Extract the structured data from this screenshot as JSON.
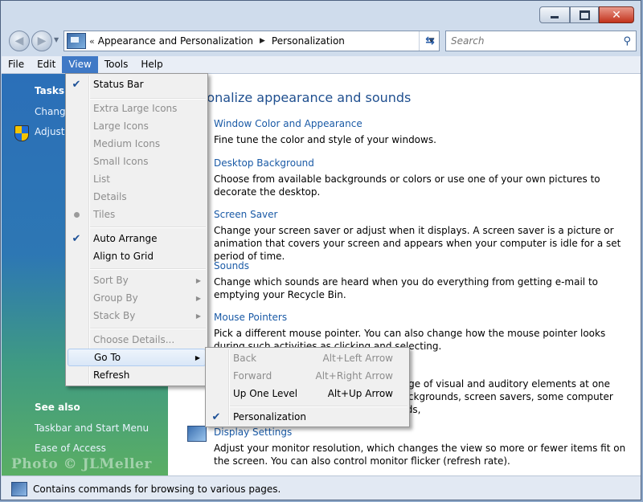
{
  "window": {
    "address": {
      "crumbs": [
        "Appearance and Personalization",
        "Personalization"
      ],
      "overflow_glyph": "«",
      "separator_glyph": "▶"
    },
    "search": {
      "placeholder": "Search"
    }
  },
  "menubar": {
    "items": [
      "File",
      "Edit",
      "View",
      "Tools",
      "Help"
    ],
    "active": "View"
  },
  "left_pane": {
    "tasks_heading": "Tasks",
    "tasks": [
      "Change",
      "Adjust"
    ],
    "see_also_heading": "See also",
    "see_also": [
      "Taskbar and Start Menu",
      "Ease of Access"
    ],
    "watermark": "Photo © JLMeller"
  },
  "main": {
    "title": "sonalize appearance and sounds",
    "items": [
      {
        "link": "Window Color and Appearance",
        "desc": "Fine tune the color and style of your windows."
      },
      {
        "link": "Desktop Background",
        "desc": "Choose from available backgrounds or colors or use one of your own pictures to decorate the desktop."
      },
      {
        "link": "Screen Saver",
        "desc": "Change your screen saver or adjust when it displays. A screen saver is a picture or animation that covers your screen and appears when your computer is idle for a set period of time."
      },
      {
        "link": "Sounds",
        "desc": "Change which sounds are heard when you do everything from getting e-mail to emptying your Recycle Bin."
      },
      {
        "link": "Mouse Pointers",
        "desc": "Pick a different mouse pointer. You can also change how the mouse pointer looks during such activities as clicking and selecting."
      },
      {
        "link": "",
        "desc": "e range of visual and auditory elements at one time ckgrounds, screen savers, some computer sounds,"
      },
      {
        "link": "Display Settings",
        "desc": "Adjust your monitor resolution, which changes the view so more or fewer items fit on the screen. You can also control monitor flicker (refresh rate)."
      }
    ]
  },
  "view_menu": {
    "items": [
      {
        "label": "Status Bar",
        "checked": true,
        "disabled": false
      },
      {
        "label": "Extra Large Icons",
        "disabled": true
      },
      {
        "label": "Large Icons",
        "disabled": true
      },
      {
        "label": "Medium Icons",
        "disabled": true
      },
      {
        "label": "Small Icons",
        "disabled": true
      },
      {
        "label": "List",
        "disabled": true
      },
      {
        "label": "Details",
        "disabled": true
      },
      {
        "label": "Tiles",
        "disabled": true,
        "radio": true
      },
      {
        "label": "Auto Arrange",
        "checked": true,
        "disabled": false
      },
      {
        "label": "Align to Grid",
        "disabled": false
      },
      {
        "label": "Sort By",
        "disabled": true,
        "submenu": true
      },
      {
        "label": "Group By",
        "disabled": true,
        "submenu": true
      },
      {
        "label": "Stack By",
        "disabled": true,
        "submenu": true
      },
      {
        "label": "Choose Details...",
        "disabled": true
      },
      {
        "label": "Go To",
        "disabled": false,
        "submenu": true,
        "highlighted": true
      },
      {
        "label": "Refresh",
        "disabled": false
      }
    ]
  },
  "goto_menu": {
    "items": [
      {
        "label": "Back",
        "accel": "Alt+Left Arrow",
        "disabled": true
      },
      {
        "label": "Forward",
        "accel": "Alt+Right Arrow",
        "disabled": true
      },
      {
        "label": "Up One Level",
        "accel": "Alt+Up Arrow",
        "disabled": false
      },
      {
        "label": "Personalization",
        "checked": true,
        "disabled": false
      }
    ]
  },
  "status_bar": {
    "text": "Contains commands for browsing to various pages."
  },
  "glyphs": {
    "check": "✔",
    "submenu_arrow": "▶",
    "close": "✕",
    "search": "⚲",
    "refresh": "⇆"
  },
  "colors": {
    "accent": "#3f79c6",
    "link": "#1a5aa6",
    "title": "#1f4f8f"
  }
}
